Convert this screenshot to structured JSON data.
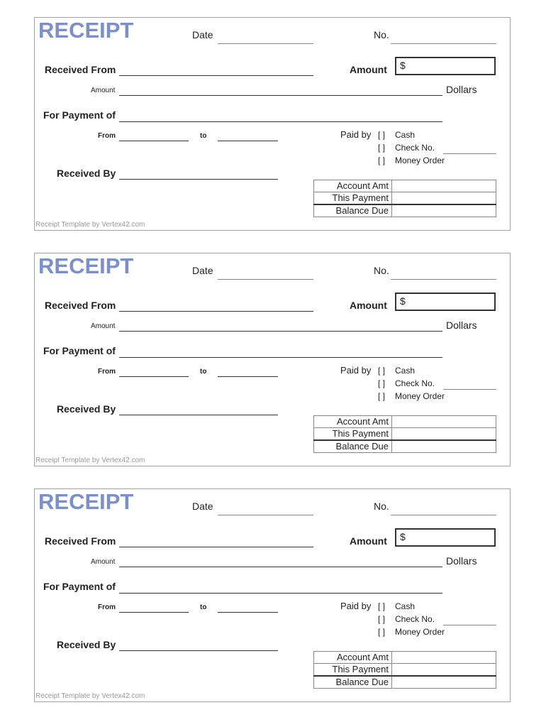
{
  "receipts": [
    {
      "title": "RECEIPT",
      "date_label": "Date",
      "no_label": "No.",
      "received_from_label": "Received From",
      "amount_label": "Amount",
      "currency_symbol": "$",
      "amount_words_label": "Amount",
      "dollars_label": "Dollars",
      "for_payment_label": "For Payment of",
      "from_label": "From",
      "to_label": "to",
      "received_by_label": "Received By",
      "paid_by_label": "Paid by",
      "checkbox_mark": "[  ]",
      "payment_methods": [
        "Cash",
        "Check No.",
        "Money Order"
      ],
      "summary_rows": [
        "Account Amt",
        "This Payment",
        "Balance Due"
      ],
      "footer": "Receipt Template by Vertex42.com"
    },
    {
      "title": "RECEIPT",
      "date_label": "Date",
      "no_label": "No.",
      "received_from_label": "Received From",
      "amount_label": "Amount",
      "currency_symbol": "$",
      "amount_words_label": "Amount",
      "dollars_label": "Dollars",
      "for_payment_label": "For Payment of",
      "from_label": "From",
      "to_label": "to",
      "received_by_label": "Received By",
      "paid_by_label": "Paid by",
      "checkbox_mark": "[  ]",
      "payment_methods": [
        "Cash",
        "Check No.",
        "Money Order"
      ],
      "summary_rows": [
        "Account Amt",
        "This Payment",
        "Balance Due"
      ],
      "footer": "Receipt Template by Vertex42.com"
    },
    {
      "title": "RECEIPT",
      "date_label": "Date",
      "no_label": "No.",
      "received_from_label": "Received From",
      "amount_label": "Amount",
      "currency_symbol": "$",
      "amount_words_label": "Amount",
      "dollars_label": "Dollars",
      "for_payment_label": "For Payment of",
      "from_label": "From",
      "to_label": "to",
      "received_by_label": "Received By",
      "paid_by_label": "Paid by",
      "checkbox_mark": "[  ]",
      "payment_methods": [
        "Cash",
        "Check No.",
        "Money Order"
      ],
      "summary_rows": [
        "Account Amt",
        "This Payment",
        "Balance Due"
      ],
      "footer": "Receipt Template by Vertex42.com"
    }
  ]
}
